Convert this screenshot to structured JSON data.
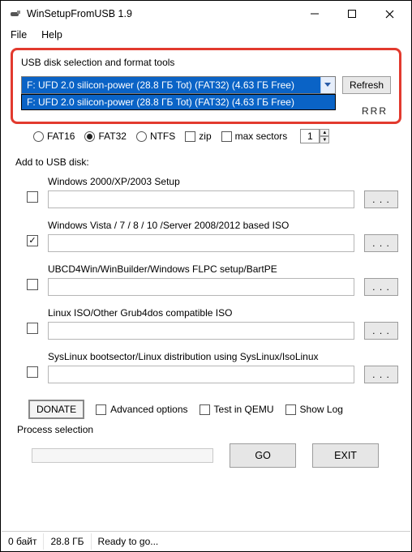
{
  "window": {
    "title": "WinSetupFromUSB 1.9"
  },
  "menu": {
    "file": "File",
    "help": "Help"
  },
  "usb_section": {
    "title": "USB disk selection and format tools",
    "selected": "F: UFD 2.0 silicon-power (28.8 ГБ Tot) (FAT32) (4.63 ГБ Free)",
    "dropdown_item": "F: UFD 2.0 silicon-power (28.8 ГБ Tot) (FAT32) (4.63 ГБ Free)",
    "refresh": "Refresh",
    "obscured_hint": "RRR"
  },
  "format_row": {
    "fat16": "FAT16",
    "fat32": "FAT32",
    "ntfs": "NTFS",
    "zip": "zip",
    "max_sectors": "max sectors",
    "spinner_value": "1"
  },
  "add_section": {
    "title": "Add to USB disk:",
    "items": [
      {
        "label": "Windows 2000/XP/2003 Setup",
        "checked": false
      },
      {
        "label": "Windows Vista / 7 / 8 / 10 /Server 2008/2012 based ISO",
        "checked": true
      },
      {
        "label": "UBCD4Win/WinBuilder/Windows FLPC setup/BartPE",
        "checked": false
      },
      {
        "label": "Linux ISO/Other Grub4dos compatible ISO",
        "checked": false
      },
      {
        "label": "SysLinux bootsector/Linux distribution using SysLinux/IsoLinux",
        "checked": false
      }
    ],
    "browse_label": ". . ."
  },
  "bottom": {
    "donate": "DONATE",
    "advanced": "Advanced options",
    "test_qemu": "Test in QEMU",
    "show_log": "Show Log",
    "process_selection": "Process selection",
    "go": "GO",
    "exit": "EXIT"
  },
  "status": {
    "bytes": "0 байт",
    "size": "28.8 ГБ",
    "msg": "Ready to go..."
  }
}
